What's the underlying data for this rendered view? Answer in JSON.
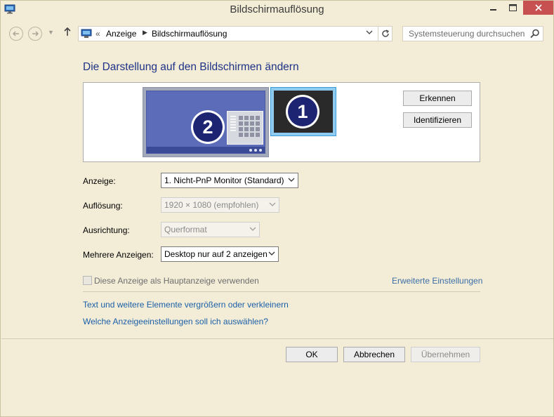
{
  "window": {
    "title": "Bildschirmauflösung",
    "icon": "display-settings-icon",
    "controls": {
      "minimize": "–",
      "maximize": "□",
      "close": "✕"
    }
  },
  "nav": {
    "back_icon": "back-arrow-icon",
    "forward_icon": "forward-arrow-icon",
    "up_icon": "up-arrow-icon",
    "breadcrumb_prefix": "«",
    "breadcrumb": [
      "Anzeige",
      "Bildschirmauflösung"
    ],
    "search_placeholder": "Systemsteuerung durchsuchen"
  },
  "main": {
    "heading": "Die Darstellung auf den Bildschirmen ändern",
    "monitors": [
      {
        "number": "1",
        "active": true
      },
      {
        "number": "2",
        "active": false
      }
    ],
    "buttons": {
      "detect": "Erkennen",
      "identify": "Identifizieren"
    },
    "fields": {
      "display_label": "Anzeige:",
      "display_value": "1. Nicht-PnP Monitor (Standard)",
      "resolution_label": "Auflösung:",
      "resolution_value": "1920 × 1080 (empfohlen)",
      "orientation_label": "Ausrichtung:",
      "orientation_value": "Querformat",
      "multiple_label": "Mehrere Anzeigen:",
      "multiple_value": "Desktop nur auf 2 anzeigen"
    },
    "checkbox_label": "Diese Anzeige als Hauptanzeige verwenden",
    "advanced_link": "Erweiterte Einstellungen",
    "links": [
      "Text und weitere Elemente vergrößern oder verkleinern",
      "Welche Anzeigeeinstellungen soll ich auswählen?"
    ]
  },
  "footer": {
    "ok": "OK",
    "cancel": "Abbrechen",
    "apply": "Übernehmen"
  },
  "colors": {
    "heading": "#1e3287",
    "link": "#1b5fa8",
    "window_bg": "#f3edd7",
    "close_button": "#c75050",
    "monitor_active_border": "#3a9bdb",
    "badge": "#1d2572"
  }
}
